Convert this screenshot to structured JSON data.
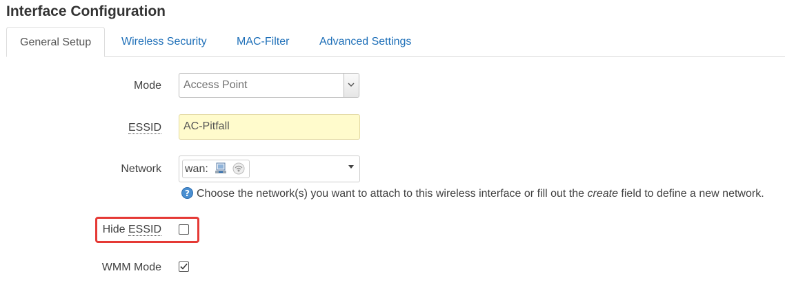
{
  "page_title": "Interface Configuration",
  "tabs": [
    {
      "label": "General Setup",
      "active": true
    },
    {
      "label": "Wireless Security",
      "active": false
    },
    {
      "label": "MAC-Filter",
      "active": false
    },
    {
      "label": "Advanced Settings",
      "active": false
    }
  ],
  "fields": {
    "mode": {
      "label": "Mode",
      "value": "Access Point"
    },
    "essid": {
      "label": "ESSID",
      "value": "AC-Pitfall"
    },
    "network": {
      "label": "Network",
      "selected": "wan:",
      "hint_before": "Choose the network(s) you want to attach to this wireless interface or fill out the ",
      "hint_em": "create",
      "hint_after": " field to define a new network."
    },
    "hide_essid": {
      "label_prefix": "Hide",
      "label_term": "ESSID",
      "checked": false
    },
    "wmm_mode": {
      "label": "WMM Mode",
      "checked": true
    }
  },
  "colors": {
    "highlight": "#e53935",
    "link": "#1e6fb8",
    "essid_field_bg": "#fffbcc"
  },
  "icons": [
    "chevron-down-icon",
    "ethernet-port-icon",
    "wireless-icon",
    "help-icon",
    "checkmark-icon"
  ]
}
